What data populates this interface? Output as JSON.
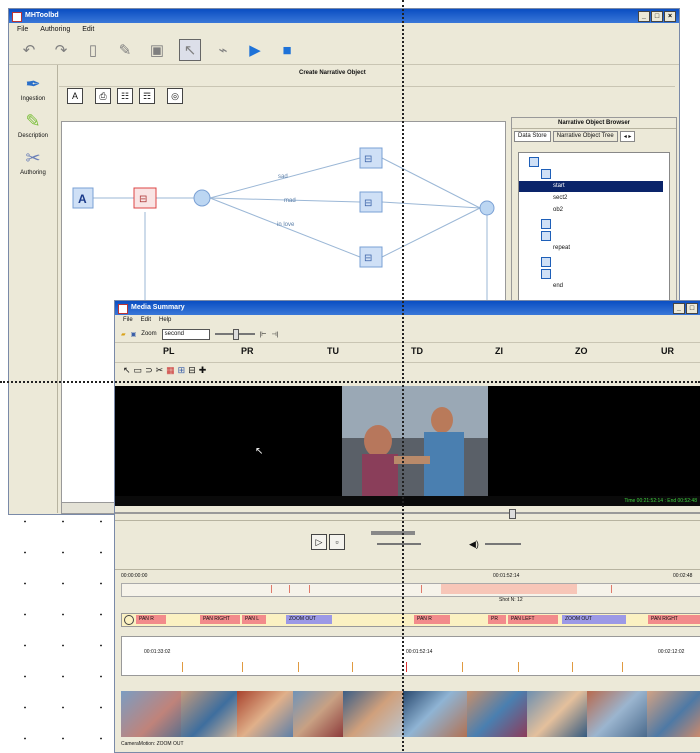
{
  "main_window": {
    "title": "MHToolbd",
    "menu": [
      "File",
      "Authoring",
      "Edit"
    ],
    "toolbar_icons": [
      "undo-icon",
      "redo-icon",
      "new-document-icon",
      "pencil-icon",
      "save-icon",
      "pointer-icon",
      "link-icon",
      "play-icon",
      "stop-icon"
    ],
    "left_panel": [
      {
        "label": "Ingestion",
        "icon": "pen-icon"
      },
      {
        "label": "Description",
        "icon": "highlighter-icon"
      },
      {
        "label": "Authoring",
        "icon": "authoring-icon"
      }
    ],
    "panel_title": "Create Narrative Object",
    "object_buttons": [
      "A",
      "⎙",
      "☷",
      "☶",
      "◎"
    ],
    "graph": {
      "edge_labels": [
        "sad",
        "mad",
        "in love"
      ],
      "start_node_label": "A"
    },
    "browser": {
      "title": "Narrative Object Browser",
      "tabs": [
        "Data Store",
        "Narrative Object Tree"
      ],
      "tree_items": [
        "start",
        "sect2",
        "ob2",
        "repeat",
        "end"
      ]
    }
  },
  "media_window": {
    "title": "Media Summary",
    "menu": [
      "File",
      "Edit",
      "Help"
    ],
    "zoom_label": "Zoom",
    "zoom_value": "second",
    "shot_types": [
      "PL",
      "PR",
      "TU",
      "TD",
      "ZI",
      "ZO",
      "UR"
    ],
    "timecode": "Time 00:21:52:14 : End 00:52:48",
    "ruler": {
      "start": "00:00:00:00",
      "mid": "00:01:52:14",
      "end": "00:02:48",
      "shot_label": "Shot N: 12"
    },
    "camera_track": [
      {
        "label": "PAN R",
        "color": "#f28b8b"
      },
      {
        "label": "PAN RIGHT",
        "color": "#f28b8b"
      },
      {
        "label": "PAN L",
        "color": "#f28b8b"
      },
      {
        "label": "ZOOM OUT",
        "color": "#9c99e6"
      },
      {
        "label": "PAN R",
        "color": "#f28b8b"
      },
      {
        "label": "PR",
        "color": "#f28b8b"
      },
      {
        "label": "PAN LEFT",
        "color": "#f28b8b"
      },
      {
        "label": "ZOOM OUT",
        "color": "#9c99e6"
      },
      {
        "label": "PAN RIGHT",
        "color": "#f28b8b"
      }
    ],
    "shot_track": {
      "left_time": "00:01:33:02",
      "mid_time": "00:01:52:14",
      "right_time": "00:02:12:02"
    },
    "status": "CameraMotion: ZOOM OUT"
  }
}
